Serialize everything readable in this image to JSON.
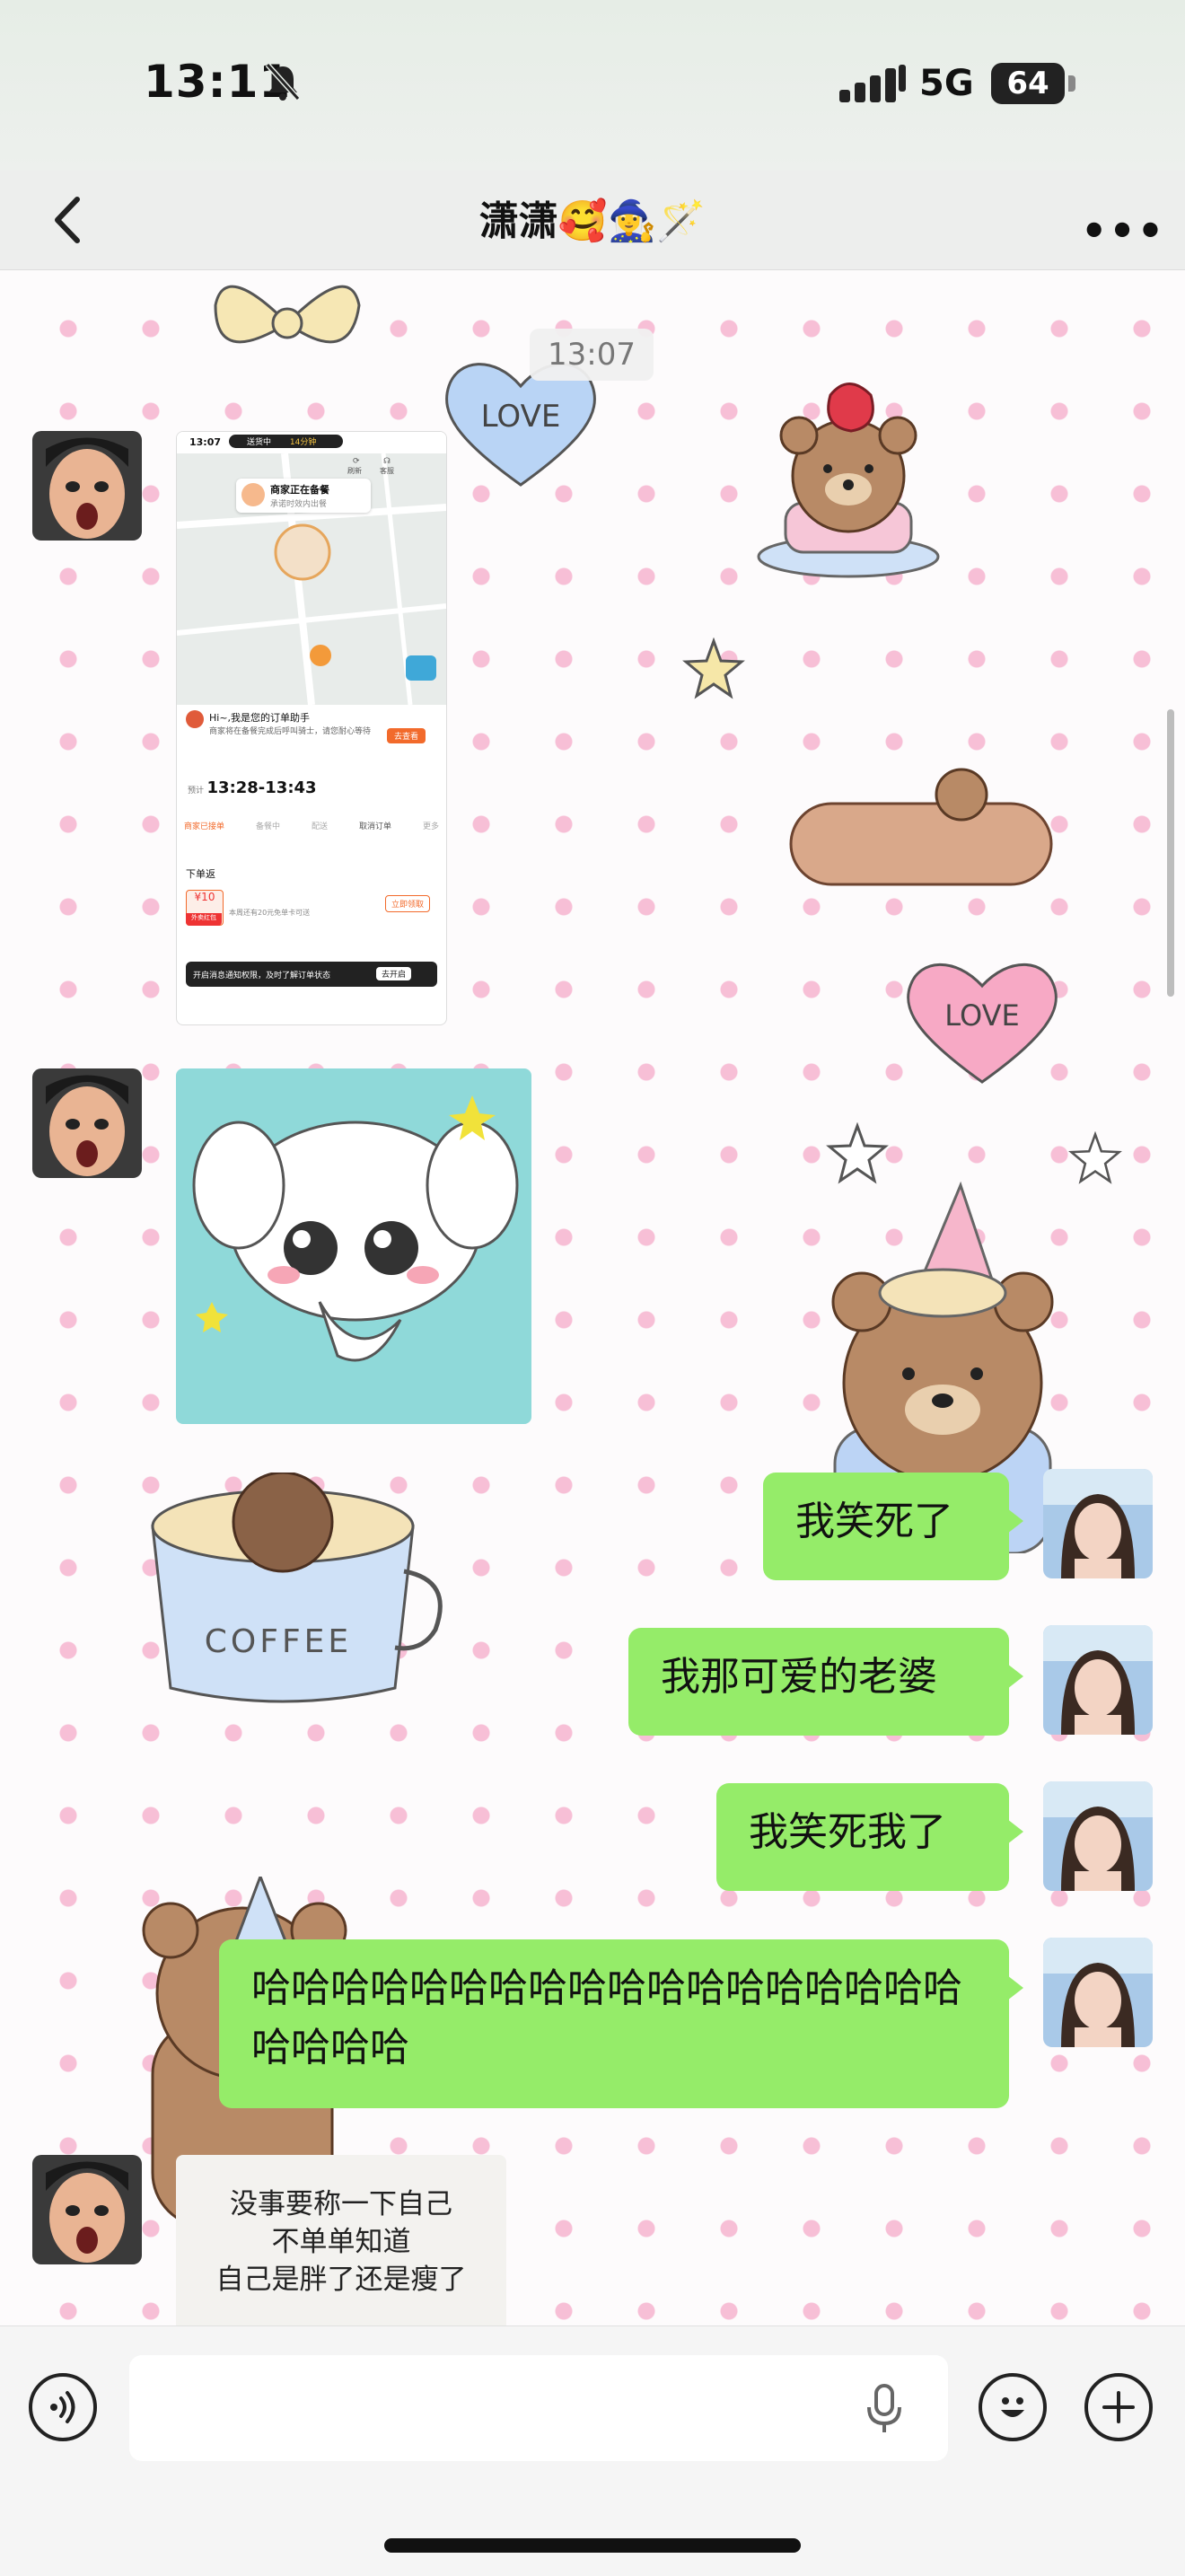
{
  "status_bar": {
    "time": "13:11",
    "network": "5G",
    "battery": "64"
  },
  "nav": {
    "title": "潇潇🥰🧙‍♀️🪄"
  },
  "chat": {
    "timestamp": "13:07",
    "screenshot": {
      "status_time": "13:07",
      "status_label": "送货中",
      "status_badge": "14分钟",
      "merchant_status": "商家正在备餐",
      "merchant_sub": "承诺时效内出餐",
      "assistant_title": "Hi~,我是您的订单助手",
      "assistant_text": "商家将在备餐完成后呼叫骑士，请您耐心等待",
      "assistant_button": "去查看",
      "eta_label": "预计",
      "eta": "13:28-13:43",
      "steps": [
        "商家已接单",
        "备餐中",
        "配送",
        "取消订单",
        "更多"
      ],
      "section_label": "下单返",
      "coupon_value": "¥10",
      "coupon_tag": "外卖红包",
      "coupon_text": "本周还有20元免单卡可送",
      "coupon_button": "立即领取",
      "notify_text": "开启消息通知权限，及时了解订单状态",
      "notify_button": "去开启",
      "side_icon_1": "刷新",
      "side_icon_2": "客服"
    },
    "sticker_text": [
      "没事要称一下自己",
      "不单单知道",
      "自己是胖了还是瘦了"
    ],
    "messages": [
      {
        "side": "right",
        "text": "我笑死了"
      },
      {
        "side": "right",
        "text": "我那可爱的老婆"
      },
      {
        "side": "right",
        "text": "我笑死我了"
      },
      {
        "side": "right",
        "text": "哈哈哈哈哈哈哈哈哈哈哈哈哈哈哈哈哈哈哈哈哈哈"
      }
    ],
    "wallpaper_text": {
      "love_1": "LOVE",
      "love_2": "LOVE",
      "coffee": "COFFEE"
    }
  },
  "input_bar": {
    "placeholder": ""
  },
  "colors": {
    "bubble": "#95ec69",
    "nav_bg": "#edeeed",
    "heart": "#f7bfd6"
  }
}
